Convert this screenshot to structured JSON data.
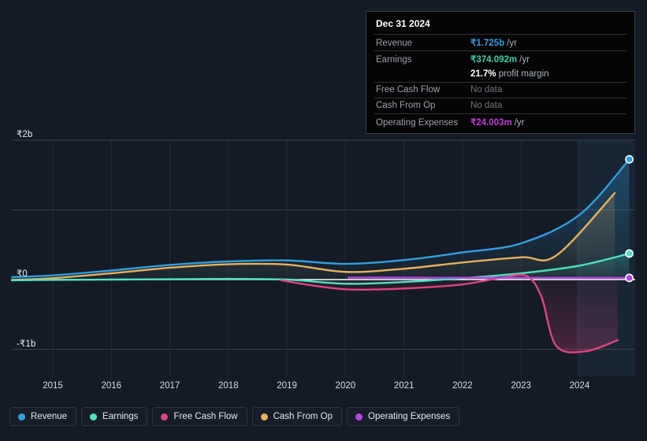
{
  "tooltip": {
    "date": "Dec 31 2024",
    "rows": [
      {
        "label": "Revenue",
        "value": "₹1.725b",
        "unit": "/yr",
        "style": "rev"
      },
      {
        "label": "Earnings",
        "value": "₹374.092m",
        "unit": "/yr",
        "style": "earn"
      },
      {
        "label": "",
        "value": "21.7%",
        "unit": "profit margin",
        "style": "margin"
      },
      {
        "label": "Free Cash Flow",
        "value": "No data",
        "unit": "",
        "style": "nodata"
      },
      {
        "label": "Cash From Op",
        "value": "No data",
        "unit": "",
        "style": "nodata"
      },
      {
        "label": "Operating Expenses",
        "value": "₹24.003m",
        "unit": "/yr",
        "style": "opex"
      }
    ]
  },
  "legend": {
    "items": [
      {
        "label": "Revenue",
        "color": "#2f9fe0"
      },
      {
        "label": "Earnings",
        "color": "#4fe0c0"
      },
      {
        "label": "Free Cash Flow",
        "color": "#e0437f"
      },
      {
        "label": "Cash From Op",
        "color": "#e8b05c"
      },
      {
        "label": "Operating Expenses",
        "color": "#b644e0"
      }
    ]
  },
  "chart_data": {
    "type": "line",
    "title": "",
    "xlabel": "",
    "ylabel": "",
    "currency": "INR",
    "grid": true,
    "legend_position": "bottom",
    "xlim": [
      2014.3,
      2024.95
    ],
    "ylim": [
      -1.3,
      2.15
    ],
    "ytick_labels": [
      "₹2b",
      "₹0",
      "-₹1b"
    ],
    "ytick_values": [
      2.0,
      0.0,
      -1.0
    ],
    "gridline_values": [
      2.0,
      1.0,
      0.0,
      -1.0
    ],
    "xtick_labels": [
      "2015",
      "2016",
      "2017",
      "2018",
      "2019",
      "2020",
      "2021",
      "2022",
      "2023",
      "2024"
    ],
    "xtick_values": [
      2015,
      2016,
      2017,
      2018,
      2019,
      2020,
      2021,
      2022,
      2023,
      2024
    ],
    "units": "billions of INR",
    "forecast_band_start": 2023.95,
    "series": [
      {
        "name": "Revenue",
        "color": "#2f9fe0",
        "end_marker": true,
        "x": [
          2014.3,
          2015,
          2016,
          2017,
          2018,
          2019,
          2020,
          2021,
          2022,
          2023,
          2024,
          2024.85
        ],
        "values": [
          0.035,
          0.06,
          0.13,
          0.21,
          0.26,
          0.275,
          0.225,
          0.28,
          0.39,
          0.52,
          0.93,
          1.725
        ]
      },
      {
        "name": "Earnings",
        "color": "#4fe0c0",
        "end_marker": true,
        "x": [
          2014.3,
          2015,
          2016,
          2017,
          2018,
          2019,
          2020,
          2021,
          2022,
          2023,
          2024,
          2024.85
        ],
        "values": [
          -0.01,
          -0.005,
          0.0,
          0.005,
          0.01,
          0.0,
          -0.06,
          -0.035,
          0.02,
          0.09,
          0.2,
          0.374
        ]
      },
      {
        "name": "Free Cash Flow",
        "color": "#e0437f",
        "end_marker": false,
        "x": [
          2018.9,
          2019.4,
          2020,
          2020.6,
          2021.2,
          2022,
          2022.7,
          2023.1,
          2023.35,
          2023.6,
          2024.1,
          2024.65
        ],
        "values": [
          -0.01,
          -0.08,
          -0.14,
          -0.14,
          -0.12,
          -0.07,
          0.03,
          0.05,
          -0.25,
          -0.95,
          -1.03,
          -0.87
        ]
      },
      {
        "name": "Cash From Op",
        "color": "#e8b05c",
        "end_marker": false,
        "x": [
          2014.3,
          2015,
          2016,
          2017,
          2018,
          2019,
          2020,
          2021,
          2022,
          2023,
          2023.6,
          2024.6
        ],
        "values": [
          -0.005,
          0.02,
          0.09,
          0.17,
          0.22,
          0.215,
          0.11,
          0.155,
          0.245,
          0.32,
          0.345,
          1.24
        ]
      },
      {
        "name": "Operating Expenses",
        "color": "#b644e0",
        "end_marker": true,
        "x": [
          2020.05,
          2021,
          2022,
          2023,
          2024,
          2024.85
        ],
        "values": [
          0.028,
          0.028,
          0.026,
          0.025,
          0.024,
          0.024
        ]
      }
    ]
  }
}
